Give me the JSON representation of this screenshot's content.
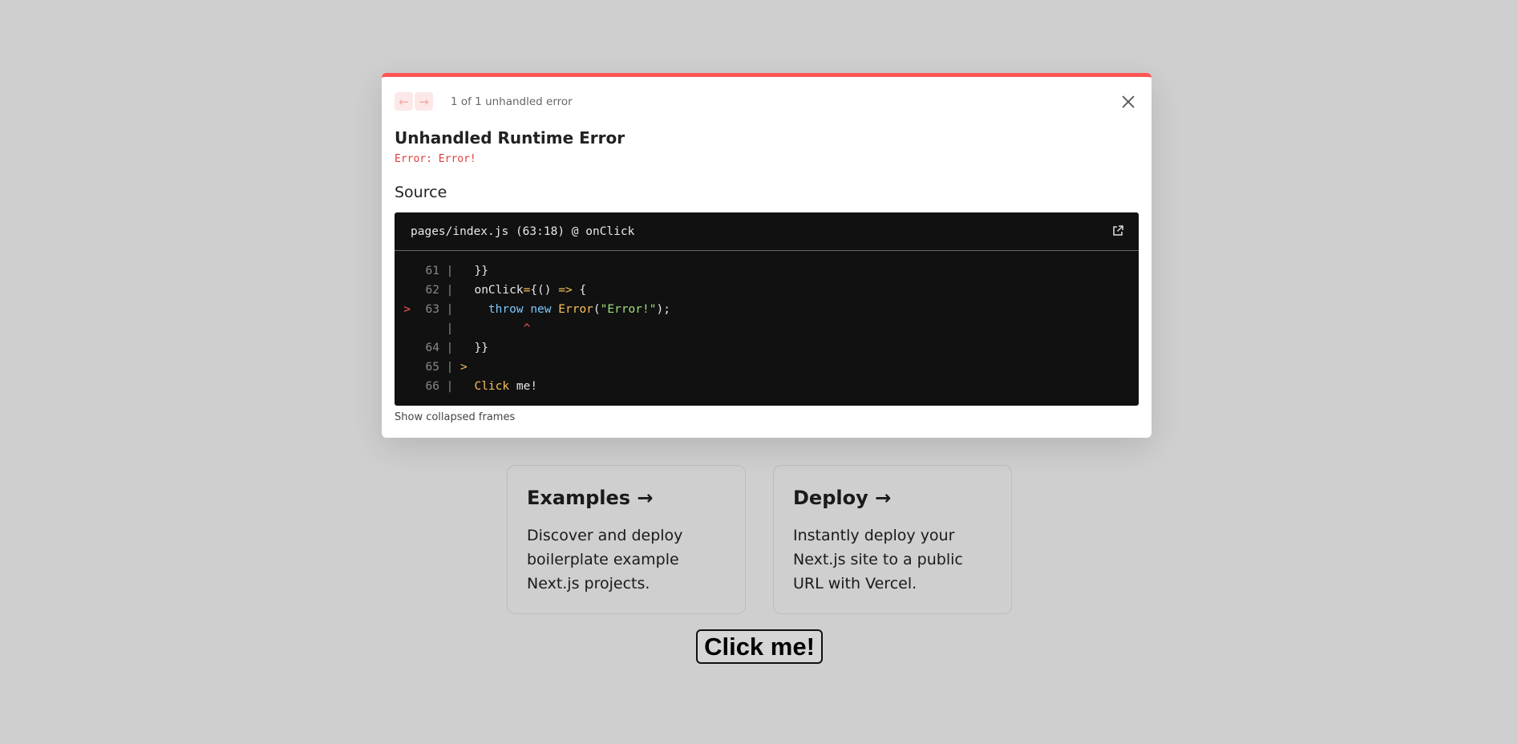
{
  "overlay": {
    "error_count": "1 of 1 unhandled error",
    "nav_prev_glyph": "←",
    "nav_next_glyph": "→",
    "title": "Unhandled Runtime Error",
    "error_message": "Error: Error!",
    "source_heading": "Source",
    "file_ref": "pages/index.js (63:18) @ onClick",
    "show_collapsed": "Show collapsed frames",
    "accent_color": "#ff5555",
    "code_lines": [
      {
        "marker": "",
        "number": "61",
        "code": "  }}"
      },
      {
        "marker": "",
        "number": "62",
        "code": "  onClick={() => {"
      },
      {
        "marker": ">",
        "number": "63",
        "code": "    throw new Error(\"Error!\");"
      },
      {
        "marker": "",
        "number": "",
        "code": "         ^"
      },
      {
        "marker": "",
        "number": "64",
        "code": "  }}"
      },
      {
        "marker": "",
        "number": "65",
        "code": ">"
      },
      {
        "marker": "",
        "number": "66",
        "code": "  Click me!"
      }
    ]
  },
  "cards": [
    {
      "title": "Examples →",
      "description": "Discover and deploy boilerplate example Next.js projects."
    },
    {
      "title": "Deploy →",
      "description": "Instantly deploy your Next.js site to a public URL with Vercel."
    }
  ],
  "click_button": "Click me!"
}
